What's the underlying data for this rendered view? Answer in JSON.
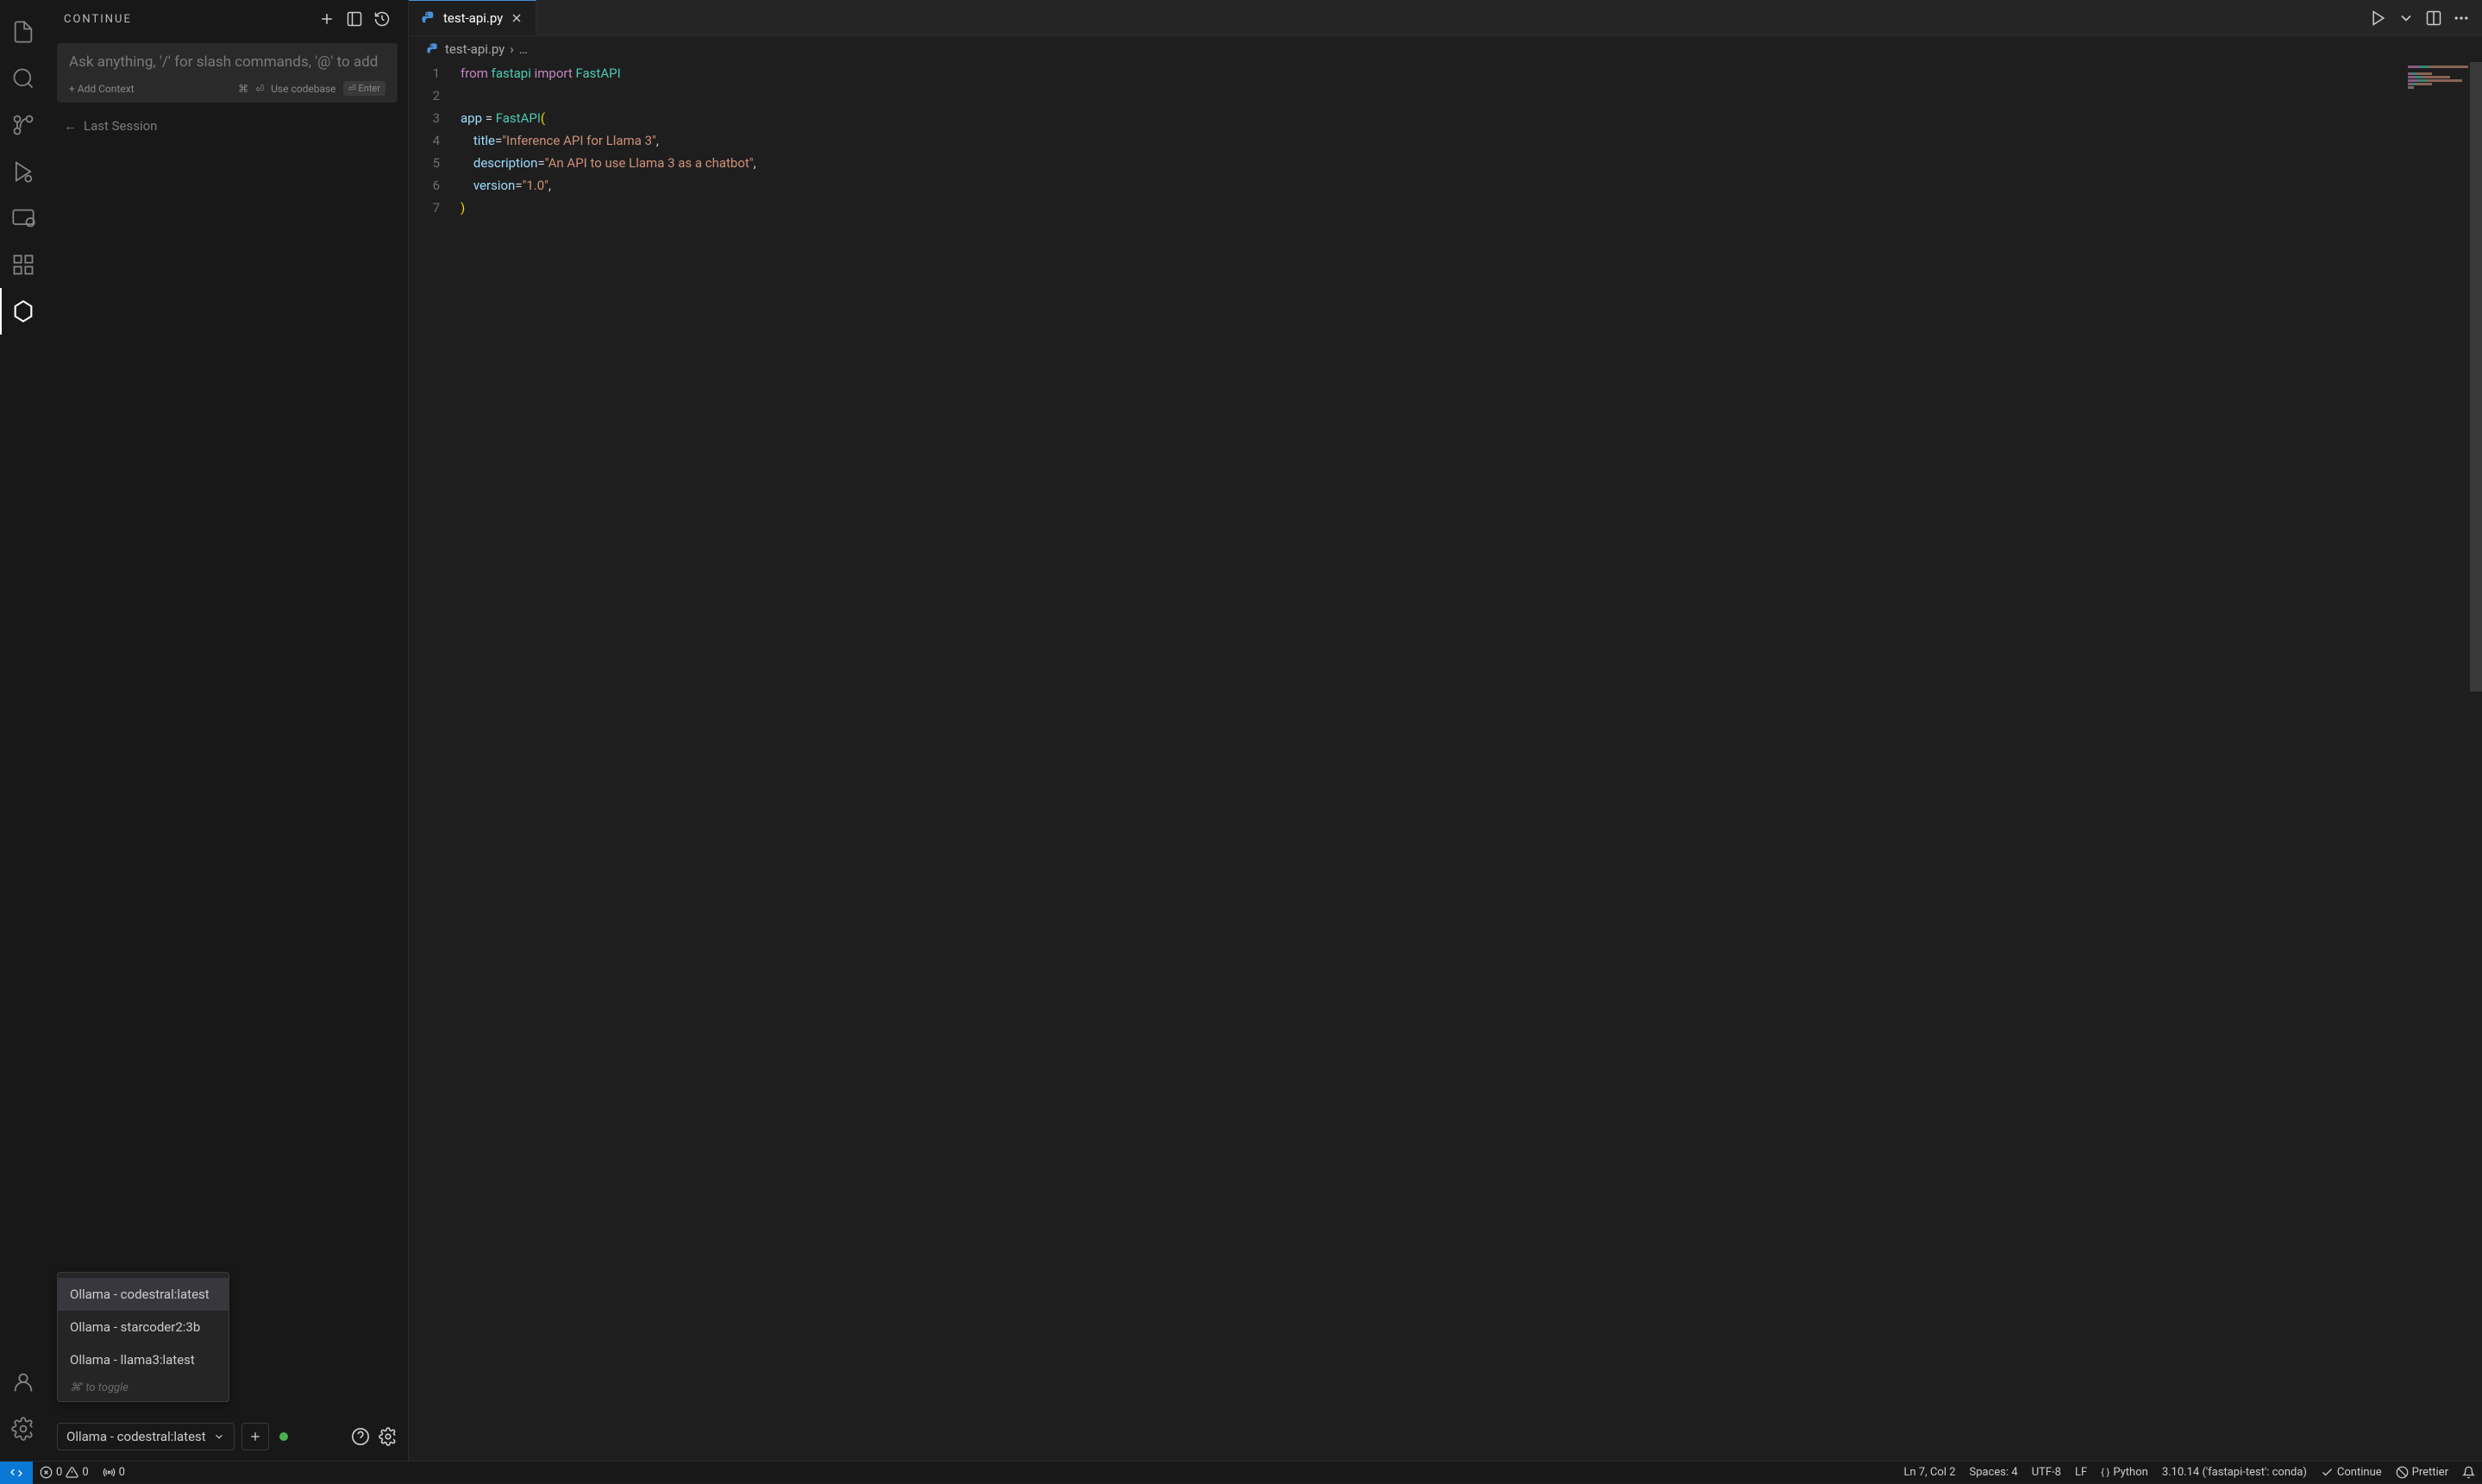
{
  "sidebar": {
    "title": "CONTINUE",
    "input_placeholder": "Ask anything, '/' for slash commands, '@' to add",
    "add_context": "+ Add Context",
    "use_codebase": "Use codebase",
    "cmd_key": "⌘",
    "enter_key": "Enter",
    "last_session": "Last Session",
    "model_options": [
      "Ollama - codestral:latest",
      "Ollama - starcoder2:3b",
      "Ollama - llama3:latest"
    ],
    "toggle_hint": "⌘' to toggle",
    "selected_model": "Ollama - codestral:latest"
  },
  "editor": {
    "tab_name": "test-api.py",
    "breadcrumb_file": "test-api.py",
    "breadcrumb_rest": "…",
    "code_lines": [
      {
        "n": 1,
        "tokens": [
          [
            "kw",
            "from"
          ],
          [
            "sp",
            " "
          ],
          [
            "mod",
            "fastapi"
          ],
          [
            "sp",
            " "
          ],
          [
            "kw",
            "import"
          ],
          [
            "sp",
            " "
          ],
          [
            "cls",
            "FastAPI"
          ]
        ]
      },
      {
        "n": 2,
        "tokens": []
      },
      {
        "n": 3,
        "tokens": [
          [
            "var",
            "app"
          ],
          [
            "sp",
            " "
          ],
          [
            "op",
            "="
          ],
          [
            "sp",
            " "
          ],
          [
            "cls",
            "FastAPI"
          ],
          [
            "brk",
            "("
          ]
        ]
      },
      {
        "n": 4,
        "indent": 1,
        "tokens": [
          [
            "var",
            "title"
          ],
          [
            "op",
            "="
          ],
          [
            "str",
            "\"Inference API for Llama 3\""
          ],
          [
            "pun",
            ","
          ]
        ]
      },
      {
        "n": 5,
        "indent": 1,
        "tokens": [
          [
            "var",
            "description"
          ],
          [
            "op",
            "="
          ],
          [
            "str",
            "\"An API to use Llama 3 as a chatbot\""
          ],
          [
            "pun",
            ","
          ]
        ]
      },
      {
        "n": 6,
        "indent": 1,
        "tokens": [
          [
            "var",
            "version"
          ],
          [
            "op",
            "="
          ],
          [
            "str",
            "\"1.0\""
          ],
          [
            "pun",
            ","
          ]
        ]
      },
      {
        "n": 7,
        "tokens": [
          [
            "brk",
            ")"
          ]
        ]
      }
    ]
  },
  "status": {
    "errors": "0",
    "warnings": "0",
    "ports": "0",
    "position": "Ln 7, Col 2",
    "spaces": "Spaces: 4",
    "encoding": "UTF-8",
    "eol": "LF",
    "language": "Python",
    "interpreter": "3.10.14 ('fastapi-test': conda)",
    "continue": "Continue",
    "prettier": "Prettier"
  }
}
